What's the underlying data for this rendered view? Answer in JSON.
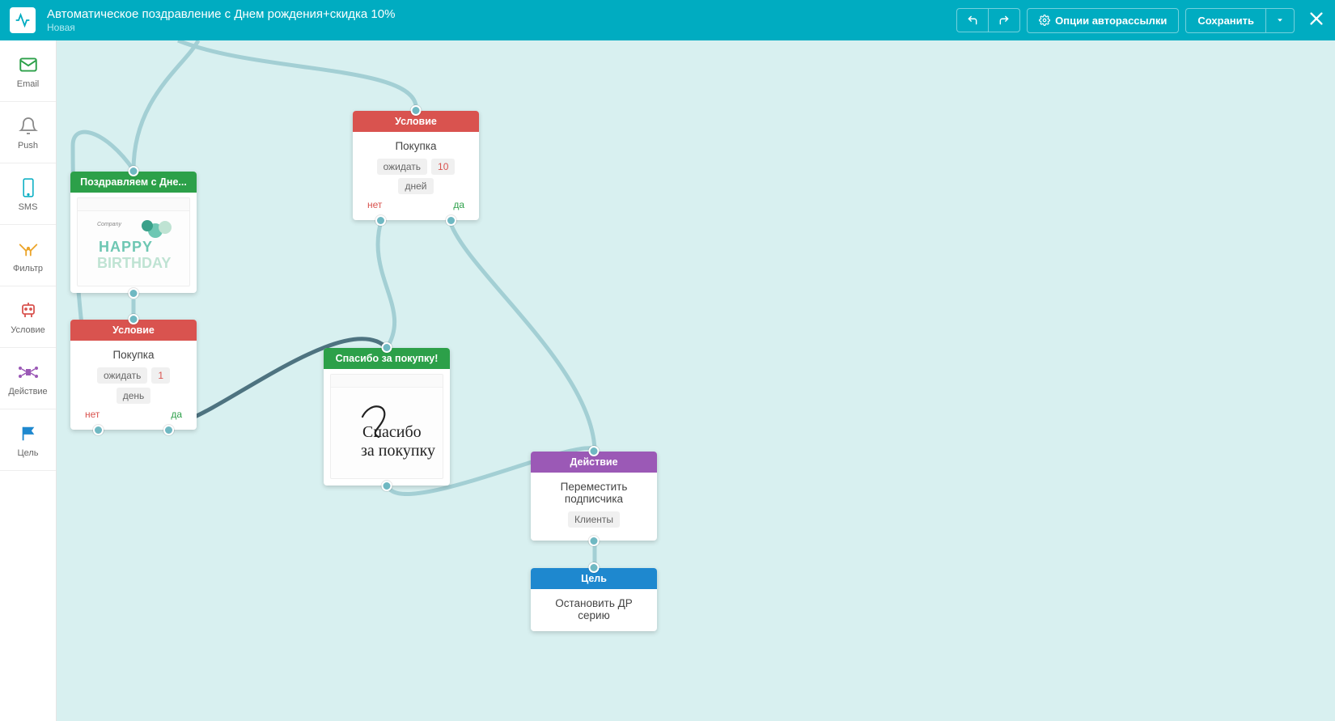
{
  "header": {
    "title": "Автоматическое поздравление с Днем рождения+скидка 10%",
    "status": "Новая",
    "options_label": "Опции авторассылки",
    "save_label": "Сохранить"
  },
  "sidebar": {
    "email": "Email",
    "push": "Push",
    "sms": "SMS",
    "filter": "Фильтр",
    "condition": "Условие",
    "action": "Действие",
    "goal": "Цель"
  },
  "nodes": {
    "email1": {
      "title": "Поздравляем с Дне..."
    },
    "cond1": {
      "title": "Условие",
      "subject": "Покупка",
      "wait": "ожидать",
      "n": "1",
      "unit": "день",
      "no": "нет",
      "yes": "да"
    },
    "cond2": {
      "title": "Условие",
      "subject": "Покупка",
      "wait": "ожидать",
      "n": "10",
      "unit": "дней",
      "no": "нет",
      "yes": "да"
    },
    "email2": {
      "title": "Спасибо за покупку!"
    },
    "action": {
      "title": "Действие",
      "line1": "Переместить",
      "line2": "подписчика",
      "tag": "Клиенты"
    },
    "goal": {
      "title": "Цель",
      "line1": "Остановить ДР",
      "line2": "серию"
    }
  }
}
